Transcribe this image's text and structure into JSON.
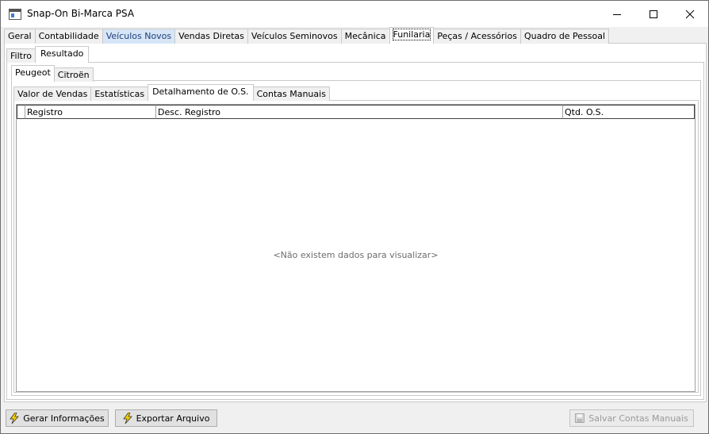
{
  "window": {
    "title": "Snap-On Bi-Marca PSA"
  },
  "main_tabs": [
    "Geral",
    "Contabilidade",
    "Veículos Novos",
    "Vendas Diretas",
    "Veículos Seminovos",
    "Mecânica",
    "Funilaria",
    "Peças / Acessórios",
    "Quadro de Pessoal"
  ],
  "view_tabs": [
    "Filtro",
    "Resultado"
  ],
  "brand_tabs": [
    "Peugeot",
    "Citroën"
  ],
  "report_tabs": [
    "Valor de Vendas",
    "Estatísticas",
    "Detalhamento de O.S.",
    "Contas Manuais"
  ],
  "grid": {
    "columns": [
      "Registro",
      "Desc. Registro",
      "Qtd. O.S."
    ],
    "empty_message": "<Não existem dados para visualizar>"
  },
  "buttons": {
    "generate": "Gerar Informações",
    "export": "Exportar Arquivo",
    "save_manual": "Salvar Contas Manuais"
  },
  "colors": {
    "tab_highlight": "#d6e6f7",
    "border": "#a0a0a0"
  }
}
